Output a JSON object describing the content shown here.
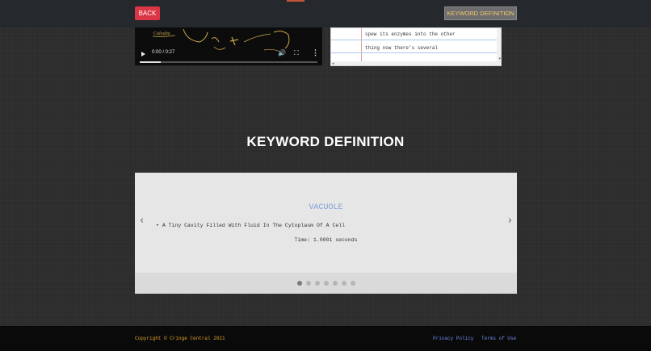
{
  "header": {
    "back_label": "BACK",
    "keyword_button_label": "KEYWORD DEFINITION"
  },
  "video": {
    "time": "0:00 / 0:27",
    "progress": 0.12,
    "scribble_text": "Calouba",
    "icons": [
      "play-icon",
      "volume-icon",
      "fullscreen-icon",
      "more-options-icon"
    ]
  },
  "transcript": {
    "lines": [
      "spew its enzymes into the other",
      "thing now there's several"
    ]
  },
  "section": {
    "title": "KEYWORD DEFINITION"
  },
  "carousel": {
    "term": "VACUOLE",
    "definition": "A Tiny Cavity Filled With Fluid In The Cytoplasm Of A Cell",
    "timing": "Time: 1.0001 seconds",
    "prev_symbol": "‹",
    "next_symbol": "›",
    "slide_count": 7,
    "active_index": 0
  },
  "footer": {
    "copyright": "Copyright © Cringe Central 2021",
    "privacy_label": "Privacy Policy",
    "terms_label": "Terms of Use"
  },
  "colors": {
    "background": "#2b2b2b",
    "back_button": "#dc3545",
    "keyword_button_text": "#f3c96b",
    "term_text": "#7fa0d8",
    "copyright_text": "#e0a32a",
    "footer_link": "#6f8ce8"
  }
}
